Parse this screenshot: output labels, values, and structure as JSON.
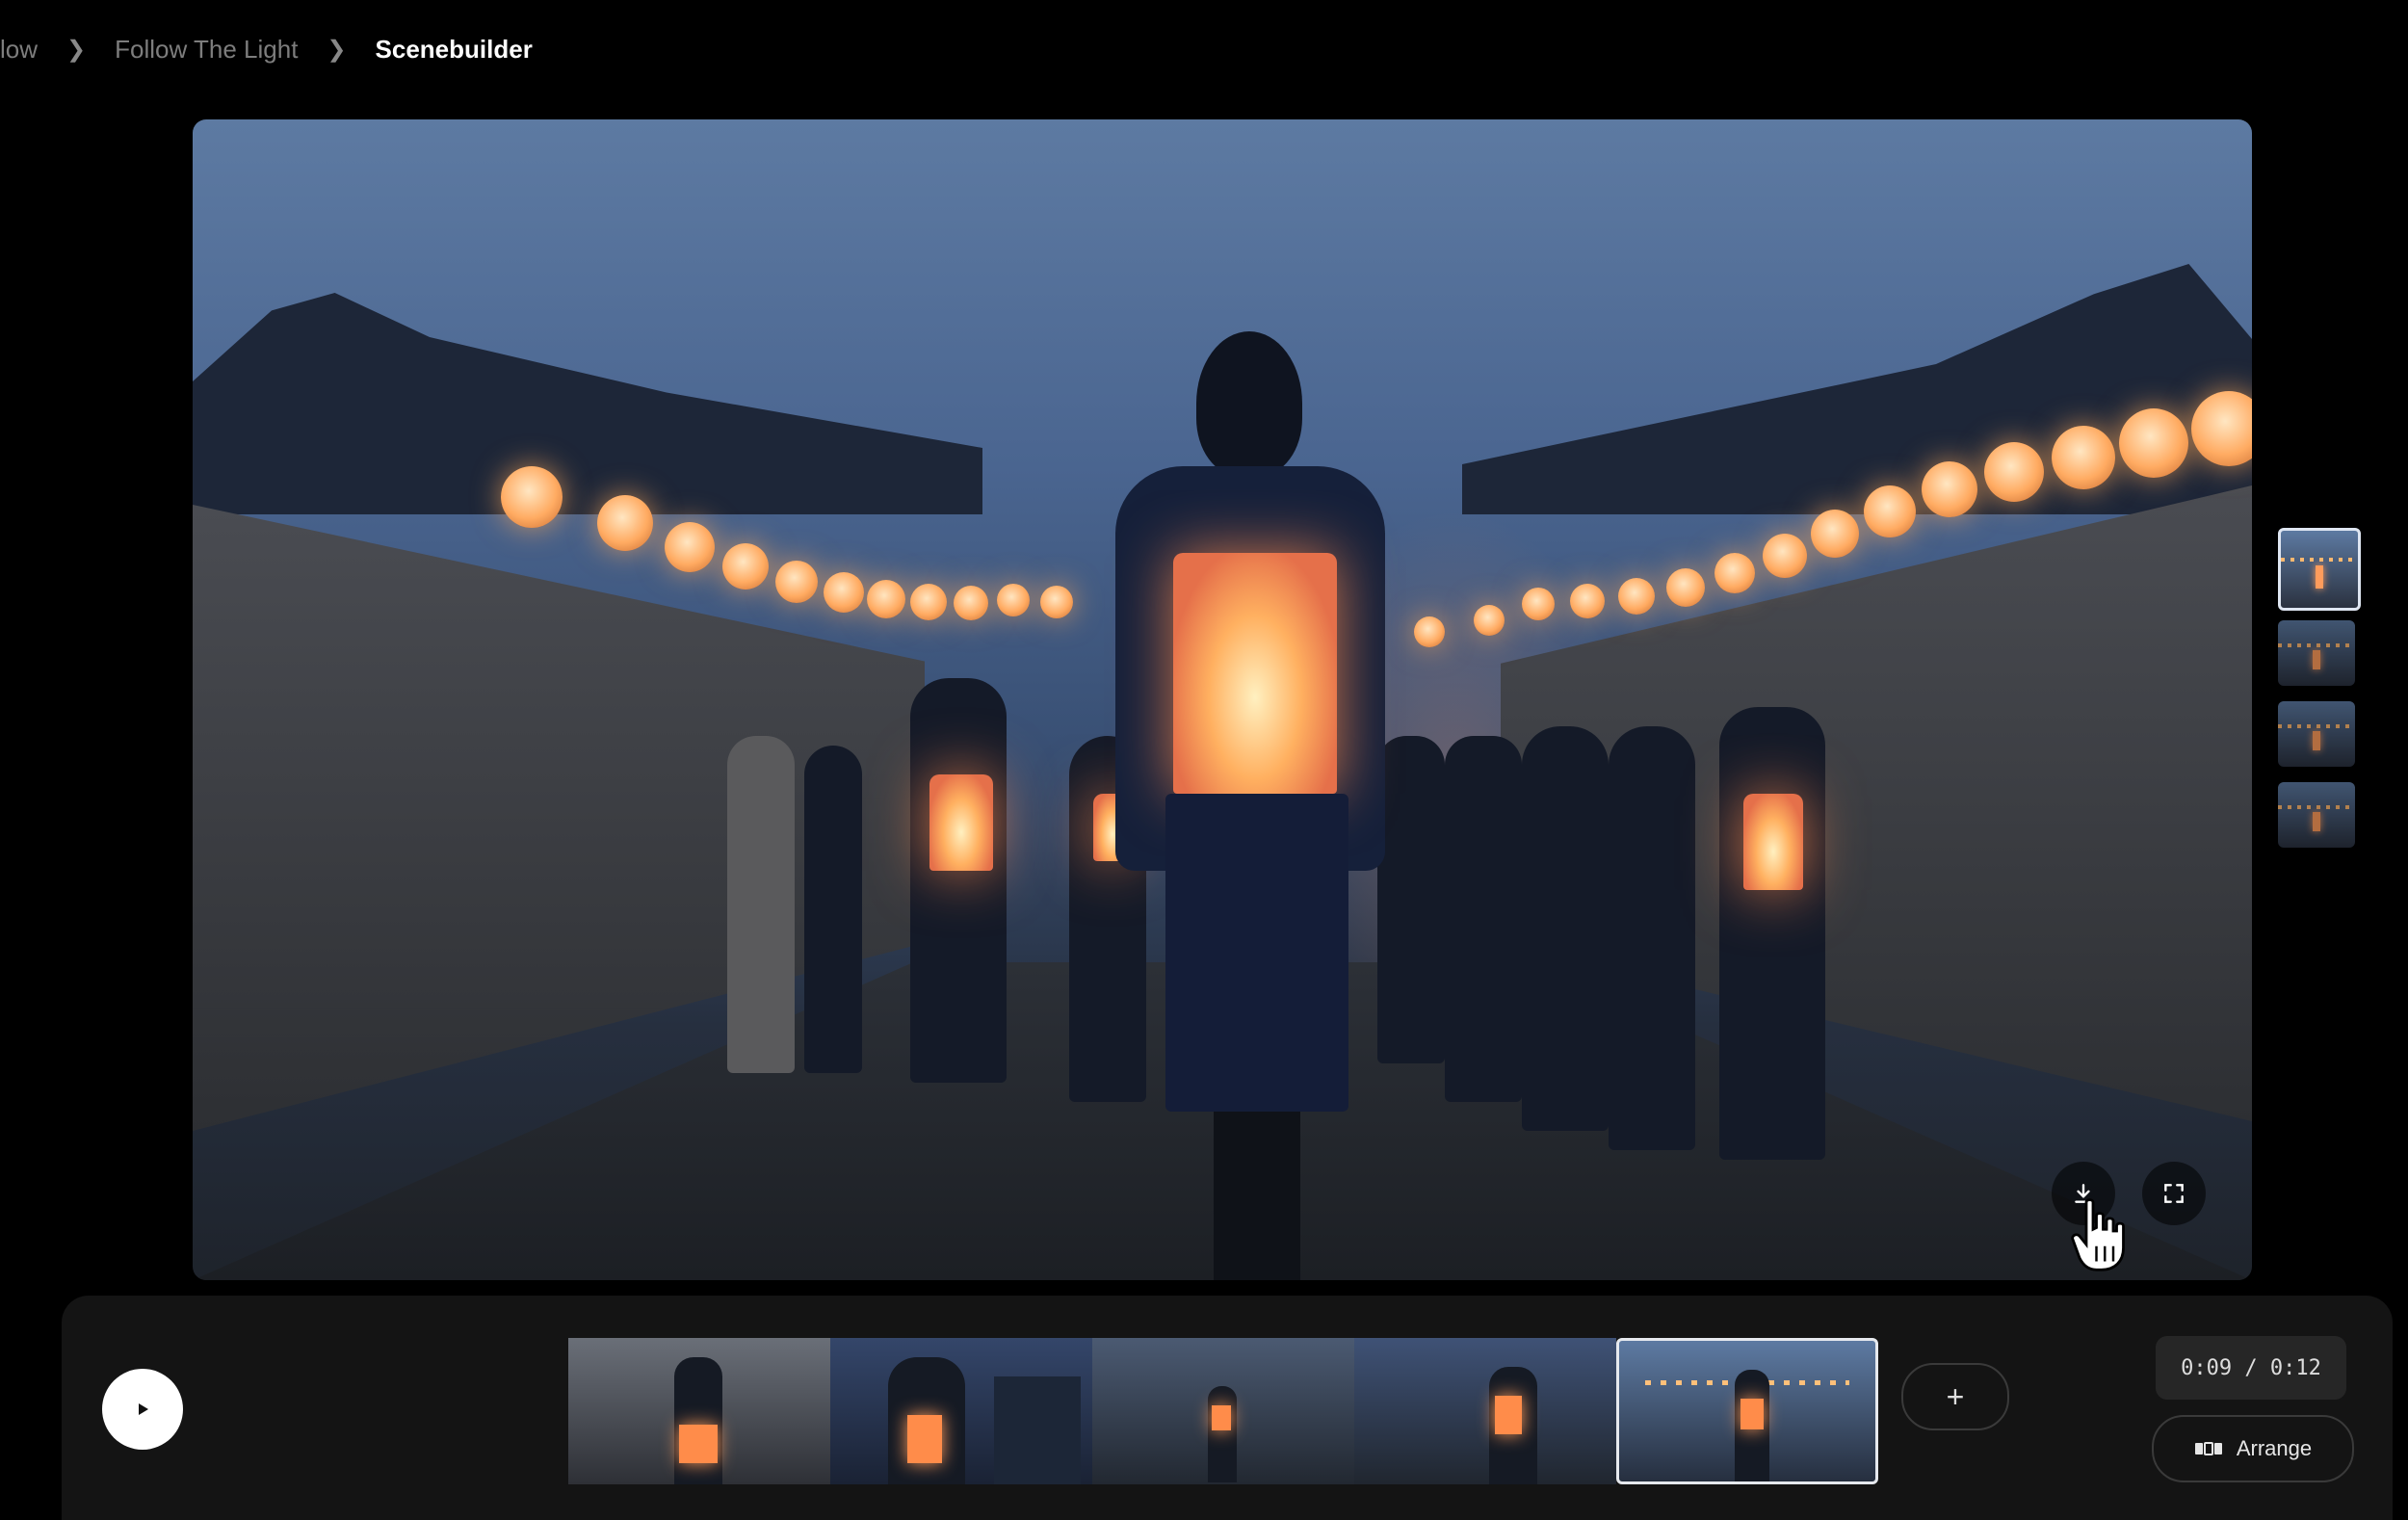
{
  "breadcrumb": {
    "items": [
      "low",
      "Follow The Light",
      "Scenebuilder"
    ]
  },
  "viewer": {
    "download_icon": "download-icon",
    "fullscreen_icon": "fullscreen-icon"
  },
  "side_thumbnails": {
    "count": 4,
    "active_index": 0
  },
  "timeline": {
    "play_icon": "play-icon",
    "add_label": "+",
    "timecode": "0:09 / 0:12",
    "arrange_label": "Arrange",
    "selected_clip": 5
  },
  "colors": {
    "background": "#000000",
    "panel": "#141414",
    "lantern_glow": "#ffab62",
    "sky": "#5d7aa2"
  }
}
